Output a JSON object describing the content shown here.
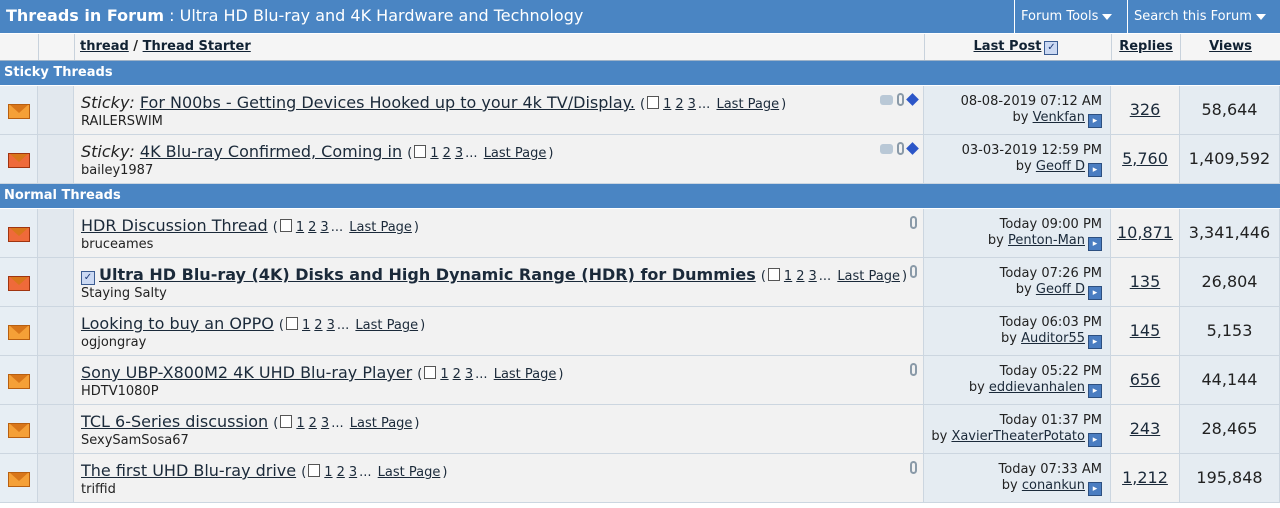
{
  "header": {
    "title_bold": "Threads in Forum",
    "title_rest": " : Ultra HD Blu-ray and 4K Hardware and Technology",
    "forum_tools": "Forum Tools",
    "search_forum": "Search this Forum"
  },
  "columns": {
    "thread": "thread",
    "separator": " / ",
    "thread_starter": "Thread Starter",
    "last_post": "Last Post",
    "replies": "Replies",
    "views": "Views"
  },
  "sections": {
    "sticky": "Sticky Threads",
    "normal": "Normal Threads"
  },
  "pager": {
    "p1": "1",
    "p2": "2",
    "p3": "3",
    "ellipsis": "...",
    "last": "Last Page"
  },
  "threads": [
    {
      "prefix": "Sticky:",
      "title": "For N00bs - Getting Devices Hooked up to your 4k TV/Display.",
      "starter": "RAILERSWIM",
      "date": "08-08-2019",
      "time": "07:12 AM",
      "by": "by",
      "user": "Venkfan",
      "replies": "326",
      "views": "58,644"
    },
    {
      "prefix": "Sticky:",
      "title": "4K Blu-ray Confirmed, Coming in",
      "starter": "bailey1987",
      "date": "03-03-2019",
      "time": "12:59 PM",
      "by": "by",
      "user": "Geoff D",
      "replies": "5,760",
      "views": "1,409,592"
    },
    {
      "title": "HDR Discussion Thread",
      "starter": "bruceames",
      "date": "Today",
      "time": "09:00 PM",
      "by": "by",
      "user": "Penton-Man",
      "replies": "10,871",
      "views": "3,341,446"
    },
    {
      "title": "Ultra HD Blu-ray (4K) Disks and High Dynamic Range (HDR) for Dummies",
      "starter": "Staying Salty",
      "date": "Today",
      "time": "07:26 PM",
      "by": "by",
      "user": "Geoff D",
      "replies": "135",
      "views": "26,804"
    },
    {
      "title": "Looking to buy an OPPO",
      "starter": "ogjongray",
      "date": "Today",
      "time": "06:03 PM",
      "by": "by",
      "user": "Auditor55",
      "replies": "145",
      "views": "5,153"
    },
    {
      "title": "Sony UBP-X800M2 4K UHD Blu-ray Player",
      "starter": "HDTV1080P",
      "date": "Today",
      "time": "05:22 PM",
      "by": "by",
      "user": "eddievanhalen",
      "replies": "656",
      "views": "44,144"
    },
    {
      "title": "TCL 6-Series discussion",
      "starter": "SexySamSosa67",
      "date": "Today",
      "time": "01:37 PM",
      "by": "by",
      "user": "XavierTheaterPotato",
      "replies": "243",
      "views": "28,465"
    },
    {
      "title": "The first UHD Blu-ray drive",
      "starter": "triffid",
      "date": "Today",
      "time": "07:33 AM",
      "by": "by",
      "user": "conankun",
      "replies": "1,212",
      "views": "195,848"
    }
  ]
}
